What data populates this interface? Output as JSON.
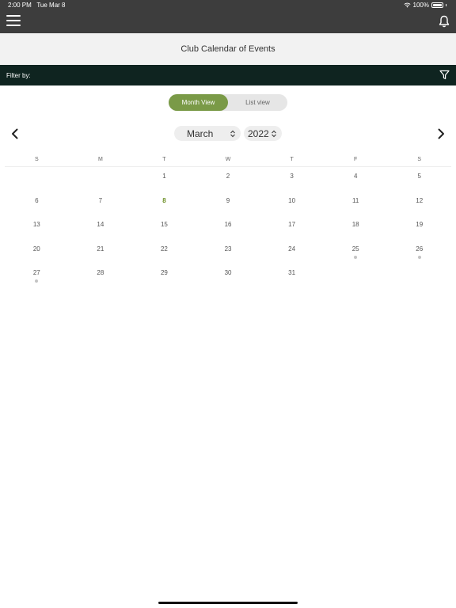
{
  "status": {
    "time": "2:00 PM",
    "date": "Tue Mar 8",
    "battery": "100%"
  },
  "header": {
    "menu_icon": "hamburger-menu-icon",
    "notification_icon": "bell-icon"
  },
  "page": {
    "title": "Club Calendar of Events"
  },
  "filter": {
    "label": "Filter by:",
    "icon": "funnel-filter-icon"
  },
  "view_toggle": {
    "month_label": "Month View",
    "list_label": "List view",
    "active": "month"
  },
  "calendar_nav": {
    "month": "March",
    "year": "2022",
    "prev_icon": "chevron-left-icon",
    "next_icon": "chevron-right-icon"
  },
  "calendar": {
    "weekdays": [
      "S",
      "M",
      "T",
      "W",
      "T",
      "F",
      "S"
    ],
    "today": "8",
    "weeks": [
      [
        "",
        "",
        "1",
        "2",
        "3",
        "4",
        "5"
      ],
      [
        "6",
        "7",
        "8",
        "9",
        "10",
        "11",
        "12"
      ],
      [
        "13",
        "14",
        "15",
        "16",
        "17",
        "18",
        "19"
      ],
      [
        "20",
        "21",
        "22",
        "23",
        "24",
        "25",
        "26"
      ],
      [
        "27",
        "28",
        "29",
        "30",
        "31",
        "",
        ""
      ]
    ],
    "event_days": [
      "25",
      "26",
      "27"
    ]
  },
  "colors": {
    "accent": "#7a9a47",
    "today": "#6b8e23",
    "filter_bar": "#0f2420",
    "topbar": "#3d3d3d"
  }
}
